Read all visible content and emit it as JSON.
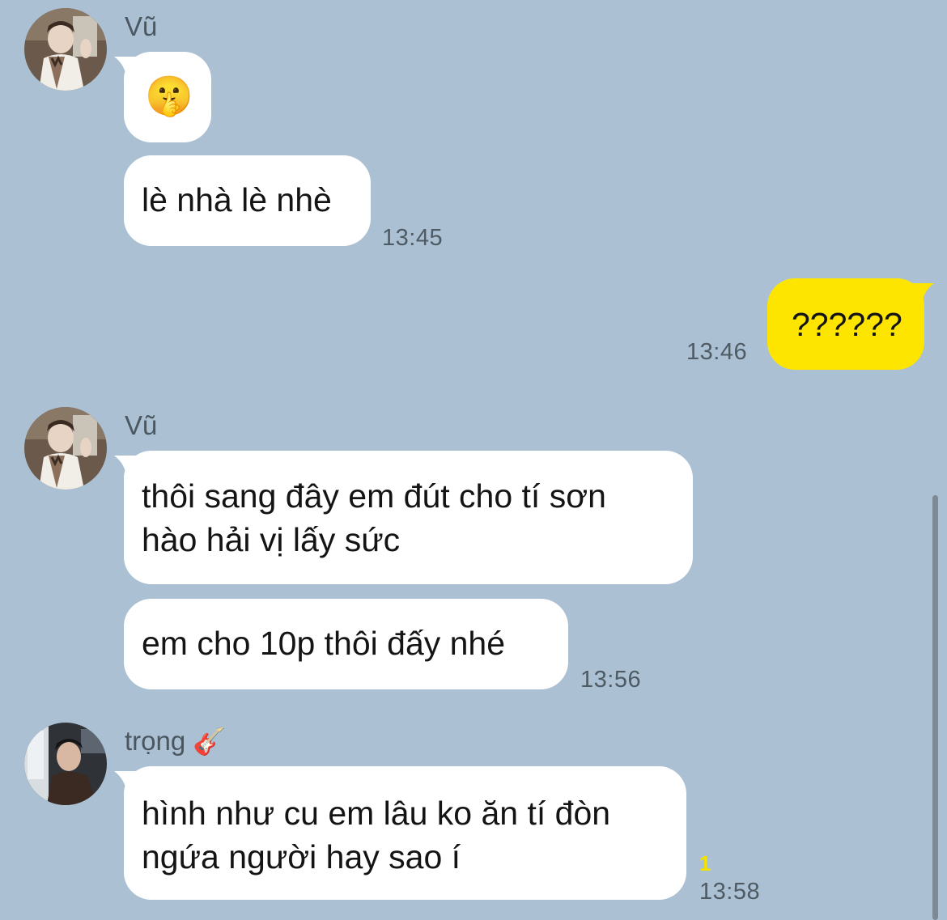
{
  "messages": {
    "block1": {
      "sender": "Vũ",
      "emoji": "🤫",
      "text": "lè nhà lè nhè",
      "time": "13:45"
    },
    "block2": {
      "text": "??????",
      "time": "13:46"
    },
    "block3": {
      "sender": "Vũ",
      "line1": "thôi sang đây em đút cho tí sơn",
      "line2": "hào hải vị lấy sức",
      "text2": "em cho 10p thôi đấy nhé",
      "time": "13:56"
    },
    "block4": {
      "sender": "trọng 🎸",
      "line1": "hình như cu em lâu ko ăn tí đòn",
      "line2": "ngứa người hay sao í",
      "unread": "1",
      "time": "13:58"
    }
  },
  "colors": {
    "background": "#abc1d3",
    "my_bubble": "#fee500",
    "other_bubble": "#ffffff"
  }
}
